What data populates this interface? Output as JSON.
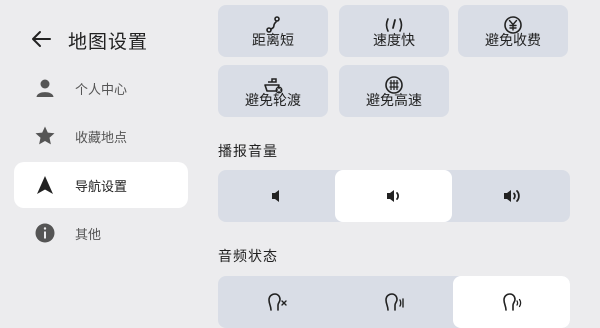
{
  "sidebar": {
    "title": "地图设置",
    "items": [
      {
        "label": "个人中心",
        "icon": "person-icon",
        "active": false
      },
      {
        "label": "收藏地点",
        "icon": "star-icon",
        "active": false
      },
      {
        "label": "导航设置",
        "icon": "navigation-arrow-icon",
        "active": true
      },
      {
        "label": "其他",
        "icon": "info-icon",
        "active": false
      }
    ]
  },
  "route_preferences": {
    "options": [
      {
        "label": "距离短",
        "icon": "short-distance-icon"
      },
      {
        "label": "速度快",
        "icon": "fast-speed-icon"
      },
      {
        "label": "避免收费",
        "icon": "avoid-toll-icon"
      },
      {
        "label": "避免轮渡",
        "icon": "avoid-ferry-icon"
      },
      {
        "label": "避免高速",
        "icon": "avoid-highway-icon"
      }
    ]
  },
  "broadcast_volume": {
    "title": "播报音量",
    "options": [
      "volume-low-icon",
      "volume-medium-icon",
      "volume-high-icon"
    ],
    "selected_index": 1
  },
  "audio_status": {
    "title": "音频状态",
    "options": [
      "voice-mute-icon",
      "voice-brief-icon",
      "voice-detailed-icon"
    ],
    "selected_index": 2
  },
  "colors": {
    "background": "#ececee",
    "button": "#d9dde6",
    "selected": "#ffffff",
    "text": "#222222"
  }
}
